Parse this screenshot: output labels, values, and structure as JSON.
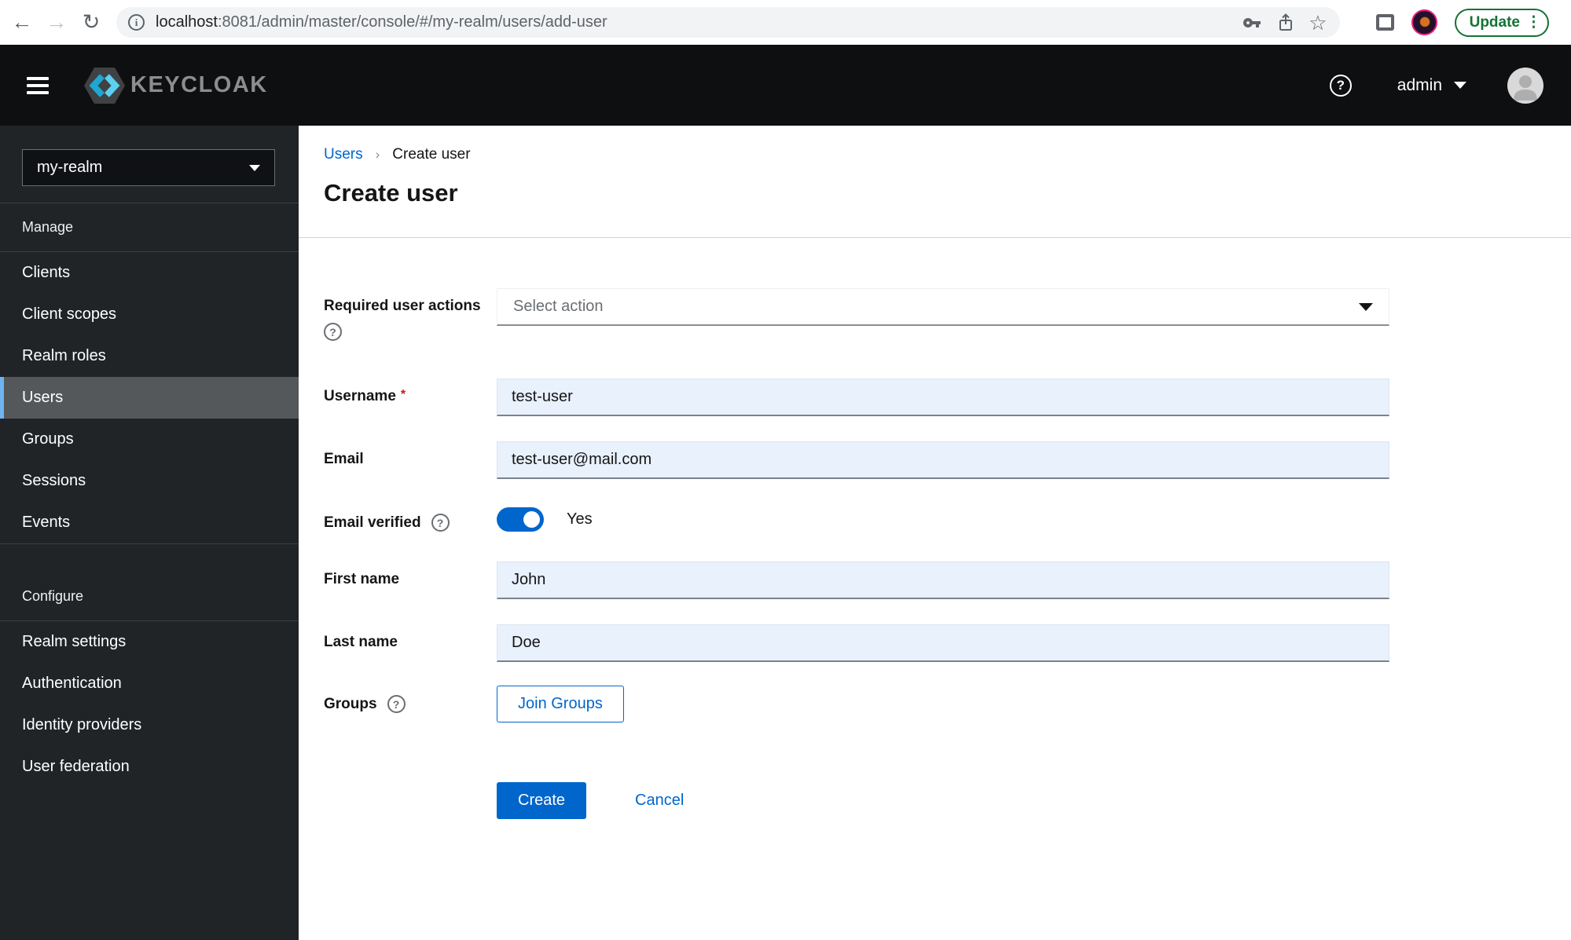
{
  "browser": {
    "url": {
      "host": "localhost",
      "rest": ":8081/admin/master/console/#/my-realm/users/add-user"
    },
    "update_button": "Update"
  },
  "header": {
    "brand": "KEYCLOAK",
    "user_menu": "admin"
  },
  "sidebar": {
    "realm_selector": "my-realm",
    "sections": [
      {
        "label": "Manage",
        "items": [
          {
            "label": "Clients"
          },
          {
            "label": "Client scopes"
          },
          {
            "label": "Realm roles"
          },
          {
            "label": "Users",
            "active": true
          },
          {
            "label": "Groups"
          },
          {
            "label": "Sessions"
          },
          {
            "label": "Events"
          }
        ]
      },
      {
        "label": "Configure",
        "items": [
          {
            "label": "Realm settings"
          },
          {
            "label": "Authentication"
          },
          {
            "label": "Identity providers"
          },
          {
            "label": "User federation"
          }
        ]
      }
    ]
  },
  "breadcrumb": {
    "parent": "Users",
    "current": "Create user"
  },
  "page": {
    "title": "Create user"
  },
  "form": {
    "required_user_actions": {
      "label": "Required user actions",
      "placeholder": "Select action"
    },
    "username": {
      "label": "Username",
      "required_marker": "*",
      "value": "test-user"
    },
    "email": {
      "label": "Email",
      "value": "test-user@mail.com"
    },
    "email_verified": {
      "label": "Email verified",
      "state": "Yes",
      "enabled": true
    },
    "first_name": {
      "label": "First name",
      "value": "John"
    },
    "last_name": {
      "label": "Last name",
      "value": "Doe"
    },
    "groups": {
      "label": "Groups",
      "join_button": "Join Groups"
    },
    "actions": {
      "create": "Create",
      "cancel": "Cancel"
    }
  },
  "colors": {
    "accent_blue": "#0066cc",
    "active_nav_indicator": "#6fb3f0",
    "sidebar_bg": "#212427",
    "masthead_bg": "#0e0f11",
    "autofill_input_bg": "#e8f1fc",
    "update_green": "#137333",
    "required_red": "#c9190b"
  }
}
